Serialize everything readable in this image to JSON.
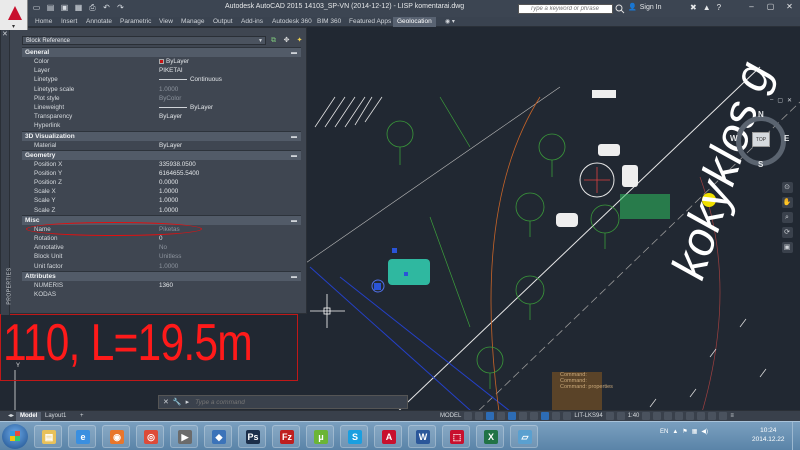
{
  "window": {
    "title": "Autodesk AutoCAD 2015     14103_SP-VN (2014-12-12) - LISP komentarai.dwg",
    "search_placeholder": "Type a keyword or phrase",
    "sign_in": "Sign In",
    "controls": [
      "–",
      "▢",
      "✕"
    ]
  },
  "ribbon": {
    "tabs": [
      "Home",
      "Insert",
      "Annotate",
      "Parametric",
      "View",
      "Manage",
      "Output",
      "Add-ins",
      "Autodesk 360",
      "BIM 360",
      "Featured Apps",
      "Geolocation"
    ],
    "active_tab": "Geolocation"
  },
  "properties": {
    "side_label": "PROPERTIES",
    "selection": "Block Reference",
    "sections": [
      {
        "title": "General",
        "rows": [
          {
            "name": "Color",
            "value": "ByLayer",
            "swatch": "#c81414"
          },
          {
            "name": "Layer",
            "value": "PIKETAI"
          },
          {
            "name": "Linetype",
            "value": "Continuous",
            "line": true
          },
          {
            "name": "Linetype scale",
            "value": "1.0000",
            "dim": true
          },
          {
            "name": "Plot style",
            "value": "ByColor",
            "dim": true
          },
          {
            "name": "Lineweight",
            "value": "ByLayer",
            "line": true
          },
          {
            "name": "Transparency",
            "value": "ByLayer"
          },
          {
            "name": "Hyperlink",
            "value": ""
          }
        ]
      },
      {
        "title": "3D Visualization",
        "rows": [
          {
            "name": "Material",
            "value": "ByLayer"
          }
        ]
      },
      {
        "title": "Geometry",
        "rows": [
          {
            "name": "Position X",
            "value": "335938.0500"
          },
          {
            "name": "Position Y",
            "value": "6164655.5400"
          },
          {
            "name": "Position Z",
            "value": "0.0000"
          },
          {
            "name": "Scale X",
            "value": "1.0000"
          },
          {
            "name": "Scale Y",
            "value": "1.0000"
          },
          {
            "name": "Scale Z",
            "value": "1.0000"
          }
        ]
      },
      {
        "title": "Misc",
        "rows": [
          {
            "name": "Name",
            "value": "Piketas",
            "dim": true,
            "circled": true
          },
          {
            "name": "Rotation",
            "value": "0"
          },
          {
            "name": "Annotative",
            "value": "No",
            "dim": true
          },
          {
            "name": "Block Unit",
            "value": "Unitless",
            "dim": true
          },
          {
            "name": "Unit factor",
            "value": "1.0000",
            "dim": true
          }
        ]
      },
      {
        "title": "Attributes",
        "rows": [
          {
            "name": "NUMERIS",
            "value": "1360"
          },
          {
            "name": "KODAS",
            "value": ""
          }
        ]
      }
    ]
  },
  "drawing": {
    "big_label": "110, L=19.5m",
    "rotated_text": "kokyklos g",
    "viewcube": {
      "top": "TOP",
      "north": "N",
      "south": "S",
      "east": "E",
      "west": "W",
      "wcs": "WCS"
    },
    "viewport_controls": [
      "–",
      "▢",
      "✕"
    ]
  },
  "command": {
    "history": [
      "Command:",
      "Command:",
      "Command: properties"
    ],
    "placeholder": "Type a command"
  },
  "layout_tabs": [
    "Model",
    "Layout1",
    "+"
  ],
  "status": {
    "model_label": "MODEL",
    "layer_label": "LIT-LKS94",
    "scale": "1:40"
  },
  "taskbar": {
    "apps": [
      {
        "name": "explorer",
        "glyph": "▤",
        "color": "#e8c15a"
      },
      {
        "name": "internet-explorer",
        "glyph": "e",
        "color": "#3a8fe0"
      },
      {
        "name": "firefox",
        "glyph": "◉",
        "color": "#e8762b"
      },
      {
        "name": "chrome",
        "glyph": "◎",
        "color": "#dd4b39"
      },
      {
        "name": "media",
        "glyph": "▶",
        "color": "#6b6b6b"
      },
      {
        "name": "virtualbox",
        "glyph": "◆",
        "color": "#3b73b9"
      },
      {
        "name": "photoshop",
        "glyph": "Ps",
        "color": "#1c2f4a"
      },
      {
        "name": "filezilla",
        "glyph": "Fz",
        "color": "#bf1f1f"
      },
      {
        "name": "utorrent",
        "glyph": "μ",
        "color": "#6bb536"
      },
      {
        "name": "skype",
        "glyph": "S",
        "color": "#1a9fe0"
      },
      {
        "name": "autocad",
        "glyph": "A",
        "color": "#c8102e"
      },
      {
        "name": "word",
        "glyph": "W",
        "color": "#2b579a"
      },
      {
        "name": "acrobat",
        "glyph": "⬚",
        "color": "#c8102e"
      },
      {
        "name": "excel",
        "glyph": "X",
        "color": "#217346"
      },
      {
        "name": "paint",
        "glyph": "▱",
        "color": "#5aa0d0"
      }
    ],
    "language": "EN",
    "time": "10:24",
    "date": "2014.12.22"
  }
}
